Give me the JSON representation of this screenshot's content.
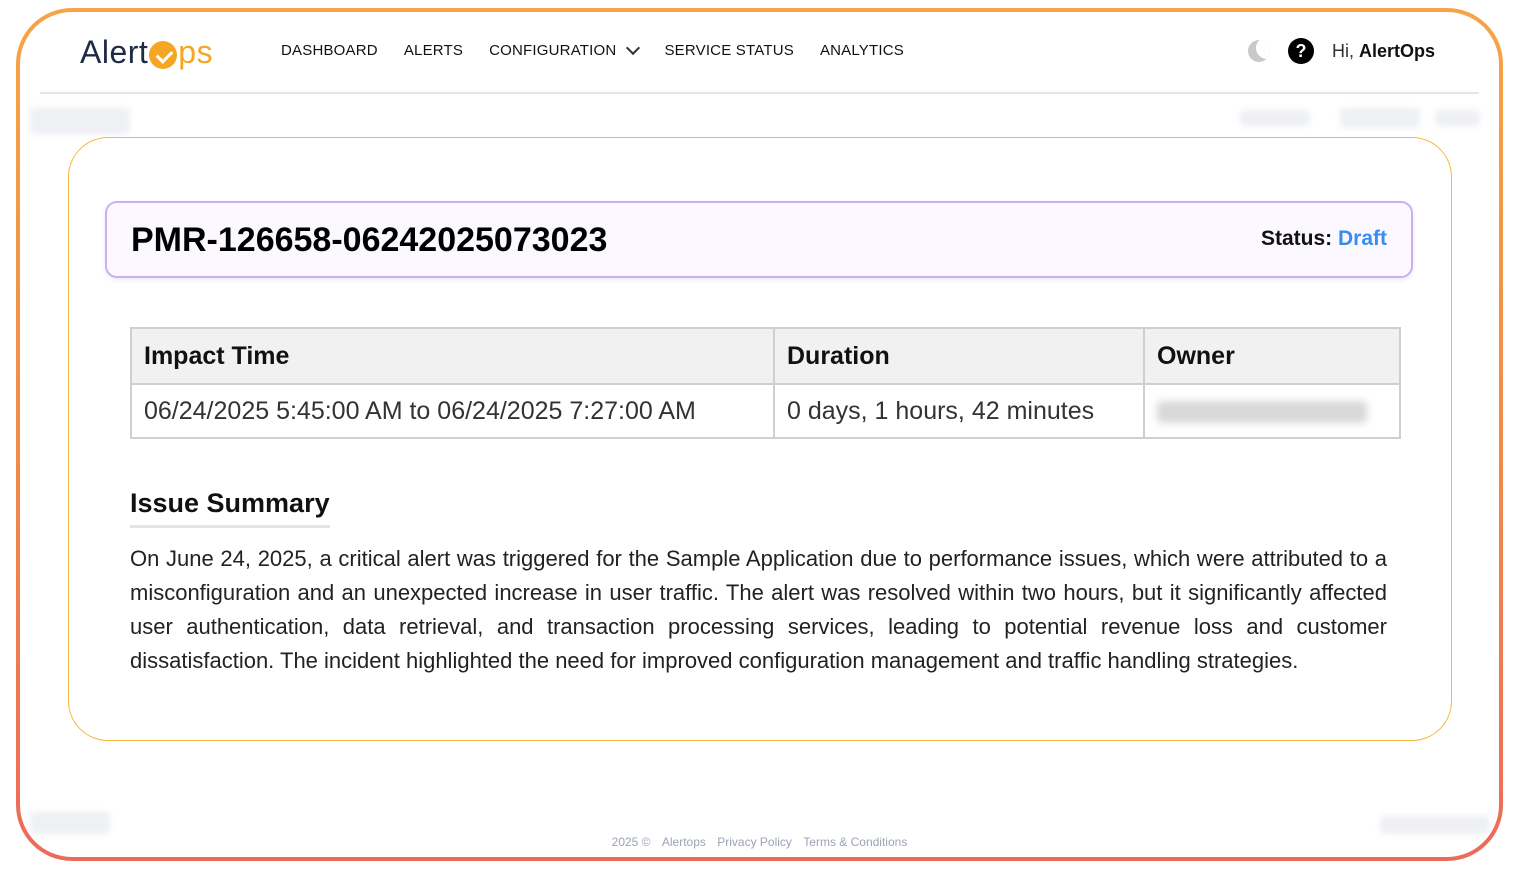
{
  "logo": {
    "alert": "Alert",
    "ps": "ps"
  },
  "nav": {
    "items": [
      {
        "label": "DASHBOARD"
      },
      {
        "label": "ALERTS"
      },
      {
        "label": "CONFIGURATION"
      },
      {
        "label": "SERVICE STATUS"
      },
      {
        "label": "ANALYTICS"
      }
    ]
  },
  "user": {
    "greeting": "Hi,",
    "name": "AlertOps"
  },
  "report": {
    "id": "PMR-126658-06242025073023",
    "status_label": "Status:",
    "status_value": "Draft",
    "status_color": "#3a8df0",
    "columns": [
      "Impact Time",
      "Duration",
      "Owner"
    ],
    "row": {
      "impact_time": "06/24/2025 5:45:00 AM to 06/24/2025 7:27:00 AM",
      "duration": "0 days, 1 hours, 42 minutes",
      "owner": ""
    },
    "summary_title": "Issue Summary",
    "summary_text": "On June 24, 2025, a critical alert was triggered for the Sample Application due to performance issues, which were attributed to a misconfiguration and an unexpected increase in user traffic. The alert was resolved within two hours, but it significantly affected user authentication, data retrieval, and transaction processing services, leading to potential revenue loss and customer dissatisfaction. The incident highlighted the need for improved configuration management and traffic handling strategies."
  },
  "footer": {
    "copyright": "2025 ©",
    "brand": "Alertops",
    "privacy": "Privacy Policy",
    "terms": "Terms & Conditions"
  },
  "colors": {
    "accent": "#f5a623",
    "frame_top": "#f6a445",
    "frame_bottom": "#ec6a5a"
  }
}
